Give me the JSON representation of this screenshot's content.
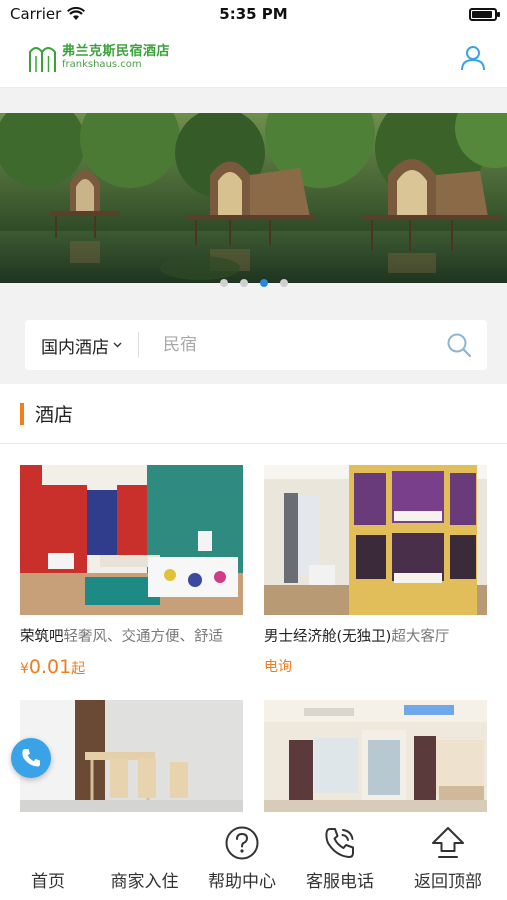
{
  "status_bar": {
    "carrier": "Carrier",
    "time": "5:35 PM"
  },
  "header": {
    "logo_cn": "弗兰克斯民宿酒店",
    "logo_en": "frankshaus.com"
  },
  "banner": {
    "slide_count": 4,
    "active_slide": 3
  },
  "search": {
    "category": "国内酒店",
    "placeholder": "民宿"
  },
  "section": {
    "title": "酒店"
  },
  "listings": [
    {
      "name": "荣筑吧",
      "desc": "轻奢风、交通方便、舒适",
      "currency": "¥",
      "price": "0.01",
      "price_suffix": "起"
    },
    {
      "name": "男士经济舱(无独卫)",
      "desc": "超大客厅",
      "price_text": "电询"
    },
    {
      "name": "",
      "desc": ""
    },
    {
      "name": "",
      "desc": ""
    }
  ],
  "bottom_nav": [
    {
      "label": "首页",
      "icon": ""
    },
    {
      "label": "商家入住",
      "icon": ""
    },
    {
      "label": "帮助中心",
      "icon": "help-icon"
    },
    {
      "label": "客服电话",
      "icon": "phone-call-icon"
    },
    {
      "label": "返回顶部",
      "icon": "up-arrow-icon"
    }
  ],
  "colors": {
    "accent": "#f07d1e",
    "brand_green": "#3ba23a",
    "link_blue": "#2a86d8"
  }
}
